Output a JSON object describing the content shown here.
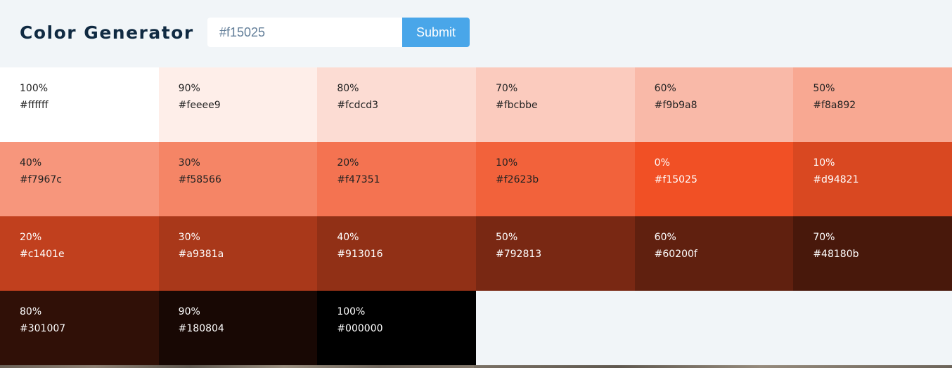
{
  "header": {
    "title": "Color Generator",
    "input_value": "#f15025",
    "submit_label": "Submit"
  },
  "colors": [
    {
      "weight": "100%",
      "hex": "#ffffff"
    },
    {
      "weight": "90%",
      "hex": "#feeee9"
    },
    {
      "weight": "80%",
      "hex": "#fcdcd3"
    },
    {
      "weight": "70%",
      "hex": "#fbcbbe"
    },
    {
      "weight": "60%",
      "hex": "#f9b9a8"
    },
    {
      "weight": "50%",
      "hex": "#f8a892"
    },
    {
      "weight": "40%",
      "hex": "#f7967c"
    },
    {
      "weight": "30%",
      "hex": "#f58566"
    },
    {
      "weight": "20%",
      "hex": "#f47351"
    },
    {
      "weight": "10%",
      "hex": "#f2623b"
    },
    {
      "weight": "0%",
      "hex": "#f15025"
    },
    {
      "weight": "10%",
      "hex": "#d94821"
    },
    {
      "weight": "20%",
      "hex": "#c1401e"
    },
    {
      "weight": "30%",
      "hex": "#a9381a"
    },
    {
      "weight": "40%",
      "hex": "#913016"
    },
    {
      "weight": "50%",
      "hex": "#792813"
    },
    {
      "weight": "60%",
      "hex": "#60200f"
    },
    {
      "weight": "70%",
      "hex": "#48180b"
    },
    {
      "weight": "80%",
      "hex": "#301007"
    },
    {
      "weight": "90%",
      "hex": "#180804"
    },
    {
      "weight": "100%",
      "hex": "#000000"
    }
  ]
}
